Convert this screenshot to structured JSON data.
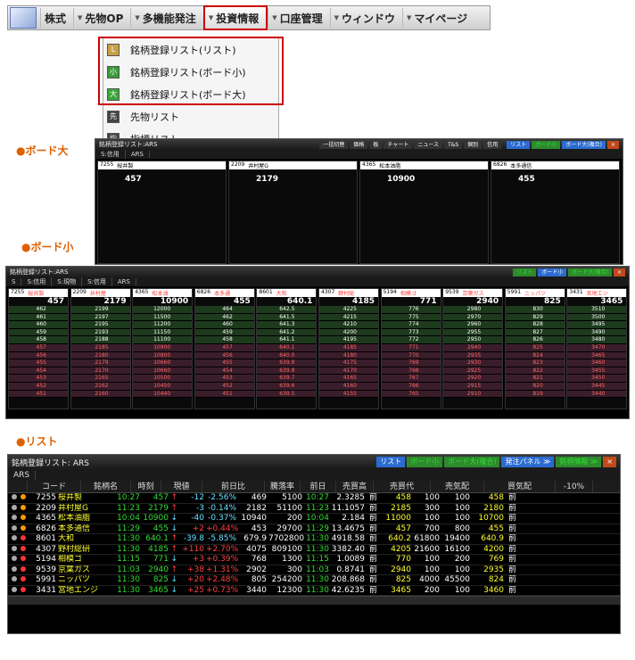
{
  "nav": {
    "items": [
      {
        "label": "株式",
        "active": false,
        "has_arrow": false
      },
      {
        "label": "先物OP",
        "active": false,
        "has_arrow": true
      },
      {
        "label": "多機能発注",
        "active": false,
        "has_arrow": true
      },
      {
        "label": "投資情報",
        "active": true,
        "has_arrow": true
      },
      {
        "label": "口座管理",
        "active": false,
        "has_arrow": true
      },
      {
        "label": "ウィンドウ",
        "active": false,
        "has_arrow": true
      },
      {
        "label": "マイページ",
        "active": false,
        "has_arrow": true
      }
    ],
    "highlight_color": "#cc0000"
  },
  "menu": {
    "items": [
      {
        "label": "銘柄登録リスト(リスト)",
        "icon": "list-icon",
        "icon_color": "#c9a04a",
        "glyph": "L"
      },
      {
        "label": "銘柄登録リスト(ボード小)",
        "icon": "board-small-icon",
        "icon_color": "#3a9a3a",
        "glyph": "小"
      },
      {
        "label": "銘柄登録リスト(ボード大)",
        "icon": "board-large-icon",
        "icon_color": "#3aa53a",
        "glyph": "大"
      },
      {
        "label": "先物リスト",
        "icon": "futures-list-icon",
        "icon_color": "#444",
        "glyph": "先"
      },
      {
        "label": "指標リスト",
        "icon": "index-list-icon",
        "icon_color": "#444",
        "glyph": "指"
      }
    ]
  },
  "sections": {
    "board_large": "●ボード大",
    "board_small": "●ボード小",
    "list": "●リスト"
  },
  "board_large": {
    "title": "銘柄登録リスト:ARS",
    "toolbar": [
      "一括切替",
      "価格",
      "板",
      "チャート",
      "ニュース",
      "T&S",
      "個別",
      "信用"
    ],
    "buttons": [
      "リスト",
      "ボード小",
      "ボード大(複合)"
    ],
    "tabs": [
      "S:信用",
      "ARS"
    ],
    "panels": [
      {
        "code": "7255",
        "name": "桜井製",
        "price": "457"
      },
      {
        "code": "2209",
        "name": "井村屋G",
        "price": "2179"
      },
      {
        "code": "4365",
        "name": "松本油脂",
        "price": "10900"
      },
      {
        "code": "6826",
        "name": "本多通信",
        "price": "455"
      }
    ]
  },
  "board_small": {
    "title": "銘柄登録リスト:ARS",
    "buttons": [
      "リスト",
      "ボード小",
      "ボード大(複合)"
    ],
    "tabs": [
      "S",
      "S:信用",
      "S:現物",
      "S:信用",
      "ARS"
    ],
    "columns": [
      {
        "code": "7255",
        "name": "桜井製",
        "price": "457",
        "bids": [
          "462",
          "461",
          "460",
          "459",
          "458",
          "457",
          "456",
          "455",
          "454",
          "453",
          "452",
          "451"
        ]
      },
      {
        "code": "2209",
        "name": "井村屋",
        "price": "2179",
        "bids": [
          "2199",
          "2197",
          "2195",
          "2193",
          "2188",
          "2185",
          "2180",
          "2179",
          "2170",
          "2165",
          "2162",
          "2160"
        ]
      },
      {
        "code": "4365",
        "name": "松本油",
        "price": "10900",
        "bids": [
          "12000",
          "11500",
          "11200",
          "11150",
          "11100",
          "10900",
          "10800",
          "10660",
          "10660",
          "10500",
          "10450",
          "10440"
        ]
      },
      {
        "code": "6826",
        "name": "本多通",
        "price": "455",
        "bids": [
          "464",
          "462",
          "460",
          "459",
          "458",
          "457",
          "456",
          "455",
          "454",
          "453",
          "452",
          "451"
        ]
      },
      {
        "code": "8601",
        "name": "大和",
        "price": "640.1",
        "bids": [
          "642.5",
          "641.5",
          "641.3",
          "641.2",
          "641.1",
          "640.1",
          "640.0",
          "639.9",
          "639.8",
          "639.7",
          "639.6",
          "639.5"
        ]
      },
      {
        "code": "4307",
        "name": "野村総",
        "price": "4185",
        "bids": [
          "4225",
          "4215",
          "4210",
          "4200",
          "4195",
          "4185",
          "4180",
          "4175",
          "4170",
          "4165",
          "4160",
          "4155"
        ]
      },
      {
        "code": "5194",
        "name": "相模ゴ",
        "price": "771",
        "bids": [
          "776",
          "775",
          "774",
          "773",
          "772",
          "771",
          "770",
          "769",
          "768",
          "767",
          "766",
          "765"
        ]
      },
      {
        "code": "9539",
        "name": "京葉ガス",
        "price": "2940",
        "bids": [
          "2980",
          "2970",
          "2960",
          "2955",
          "2950",
          "2940",
          "2935",
          "2930",
          "2925",
          "2920",
          "2915",
          "2910"
        ]
      },
      {
        "code": "5991",
        "name": "ニッパツ",
        "price": "825",
        "bids": [
          "830",
          "829",
          "828",
          "827",
          "826",
          "825",
          "824",
          "823",
          "822",
          "821",
          "820",
          "819"
        ]
      },
      {
        "code": "3431",
        "name": "宮地エン",
        "price": "3465",
        "bids": [
          "3510",
          "3500",
          "3495",
          "3490",
          "3480",
          "3470",
          "3465",
          "3460",
          "3455",
          "3450",
          "3445",
          "3440"
        ]
      }
    ]
  },
  "list": {
    "title": "銘柄登録リスト: ARS",
    "buttons": [
      "リスト",
      "ボード小",
      "ボード大(複合)",
      "発注パネル ≫",
      "銘柄情報 ≫"
    ],
    "tab": "ARS",
    "headers": [
      "コード",
      "銘柄名",
      "時刻",
      "現値",
      "前日比",
      "騰落率",
      "前日",
      "売買高",
      "売買代",
      "売気配",
      "買気配"
    ],
    "rows": [
      [
        "7255",
        "桜井製",
        "10:27",
        "457",
        "↑",
        "-12",
        "-2.56%",
        "469",
        "5100",
        "10:27",
        "2.3285",
        "前",
        "458",
        "100",
        "100",
        "458",
        "前"
      ],
      [
        "2209",
        "井村屋G",
        "11:23",
        "2179",
        "↑",
        "-3",
        "-0.14%",
        "2182",
        "51100",
        "11:23",
        "11.1057",
        "前",
        "2185",
        "300",
        "100",
        "2180",
        "前"
      ],
      [
        "4365",
        "松本油脂",
        "10:04",
        "10900",
        "↓",
        "-40",
        "-0.37%",
        "10940",
        "200",
        "10:04",
        "2.184",
        "前",
        "11000",
        "100",
        "100",
        "10700",
        "前"
      ],
      [
        "6826",
        "本多通信",
        "11:29",
        "455",
        "↓",
        "+2",
        "+0.44%",
        "453",
        "29700",
        "11:29",
        "13.4675",
        "前",
        "457",
        "700",
        "800",
        "455",
        "前"
      ],
      [
        "8601",
        "大和",
        "11:30",
        "640.1",
        "↑",
        "-39.8",
        "-5.85%",
        "679.9",
        "7702800",
        "11:30",
        "4918.58",
        "前",
        "640.2",
        "61800",
        "19400",
        "640.9",
        "前"
      ],
      [
        "4307",
        "野村総研",
        "11:30",
        "4185",
        "↑",
        "+110",
        "+2.70%",
        "4075",
        "809100",
        "11:30",
        "3382.40",
        "前",
        "4205",
        "21600",
        "16100",
        "4200",
        "前"
      ],
      [
        "5194",
        "相模ゴ",
        "11:15",
        "771",
        "↓",
        "+3",
        "+0.39%",
        "768",
        "1300",
        "11:15",
        "1.0089",
        "前",
        "770",
        "100",
        "200",
        "769",
        "前"
      ],
      [
        "9539",
        "京葉ガス",
        "11:03",
        "2940",
        "↑",
        "+38",
        "+1.31%",
        "2902",
        "300",
        "11:03",
        "0.8741",
        "前",
        "2940",
        "100",
        "100",
        "2935",
        "前"
      ],
      [
        "5991",
        "ニッパツ",
        "11:30",
        "825",
        "↓",
        "+20",
        "+2.48%",
        "805",
        "254200",
        "11:30",
        "208.868",
        "前",
        "825",
        "4000",
        "45500",
        "824",
        "前"
      ],
      [
        "3431",
        "宮地エンジ",
        "11:30",
        "3465",
        "↓",
        "+25",
        "+0.73%",
        "3440",
        "12300",
        "11:30",
        "42.6235",
        "前",
        "3465",
        "200",
        "100",
        "3460",
        "前"
      ]
    ],
    "extra_header": "-10%"
  }
}
